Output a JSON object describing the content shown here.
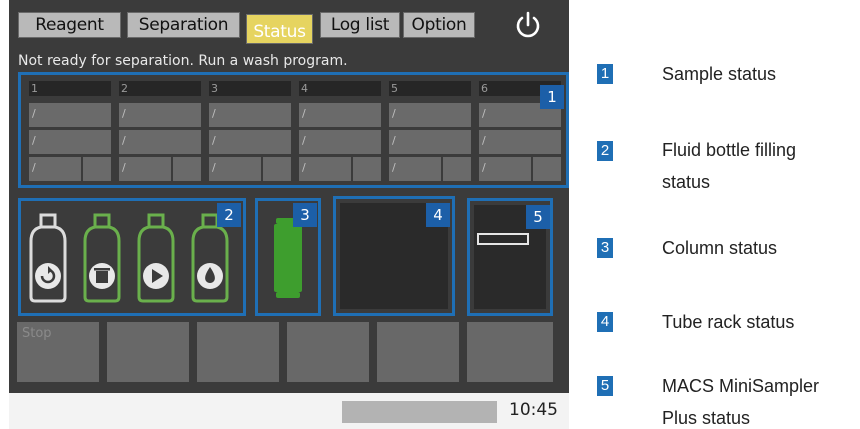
{
  "tabs": [
    {
      "label": "Reagent"
    },
    {
      "label": "Separation"
    },
    {
      "label": "Status"
    },
    {
      "label": "Log list"
    },
    {
      "label": "Option"
    }
  ],
  "active_tab": "Status",
  "status_message": "Not ready for separation. Run a wash program.",
  "sample_positions": [
    "1",
    "2",
    "3",
    "4",
    "5",
    "6"
  ],
  "empty_cell_mark": "/",
  "panel_numbers": [
    "1",
    "2",
    "3",
    "4",
    "5"
  ],
  "bottom_buttons": [
    {
      "label": "Stop"
    },
    {
      "label": ""
    },
    {
      "label": ""
    },
    {
      "label": ""
    },
    {
      "label": ""
    },
    {
      "label": ""
    }
  ],
  "status_bar": {
    "time": "10:45"
  },
  "legend": [
    {
      "num": "1",
      "text": "Sample status"
    },
    {
      "num": "2",
      "text_line1": "Fluid bottle filling",
      "text_line2": "status"
    },
    {
      "num": "3",
      "text": "Column status"
    },
    {
      "num": "4",
      "text": "Tube rack status"
    },
    {
      "num": "5",
      "text_line1": "MACS MiniSampler",
      "text_line2": "Plus status"
    }
  ],
  "colors": {
    "accent_blue": "#1f6fb5",
    "active_tab": "#e6d460",
    "bottle_green": "#6ab04c",
    "column_green": "#3e9e2e"
  },
  "icons": [
    "power-icon",
    "refresh-icon",
    "trash-icon",
    "play-icon",
    "drop-icon",
    "column-icon",
    "tray-icon"
  ]
}
